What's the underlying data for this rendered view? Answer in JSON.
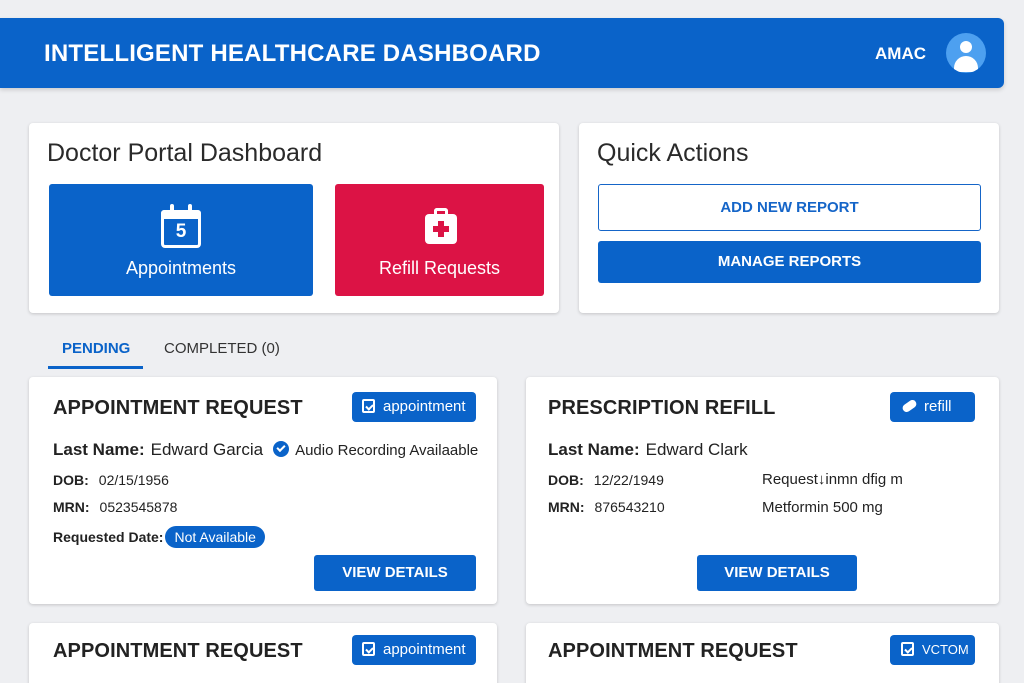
{
  "header": {
    "title": "INTELLIGENT HEALTHCARE DASHBOARD",
    "user": "AMAC",
    "avatar_icon": "user-avatar-icon"
  },
  "portal": {
    "title": "Doctor Portal Dashboard",
    "appointments": {
      "count": "5",
      "label": "Appointments",
      "icon": "calendar-icon",
      "color": "#0a63c9"
    },
    "refills": {
      "label": "Refill Requests",
      "icon": "medical-kit-icon",
      "color": "#dc1345"
    }
  },
  "quick_actions": {
    "title": "Quick Actions",
    "add_label": "ADD NEW REPORT",
    "manage_label": "MANAGE REPORTS"
  },
  "tabs": {
    "pending": "PENDING",
    "completed": "COMPLETED (0)"
  },
  "cards": [
    {
      "title": "APPOINTMENT REQUEST",
      "badge": "appointment",
      "last_name_label": "Last Name:",
      "last_name": "Edward Garcia",
      "audio": "Audio Recording Availaable",
      "dob_label": "DOB:",
      "dob": "02/15/1956",
      "mrn_label": "MRN:",
      "mrn": "0523545878",
      "requested_label": "Requested Date:",
      "requested_value": "Not Available",
      "button": "VIEW DETAILS"
    },
    {
      "title": "PRESCRIPTION REFILL",
      "badge": "refill",
      "last_name_label": "Last Name:",
      "last_name": "Edward Clark",
      "dob_label": "DOB:",
      "dob": "12/22/1949",
      "mrn_label": "MRN:",
      "mrn": "876543210",
      "request_text": "Request↓inmn dfig m",
      "medication": "Metformin 500 mg",
      "button": "VIEW DETAILS"
    },
    {
      "title": "APPOINTMENT REQUEST",
      "badge": "appointment"
    },
    {
      "title": "APPOINTMENT REQUEST",
      "badge": "VCTOM"
    }
  ]
}
